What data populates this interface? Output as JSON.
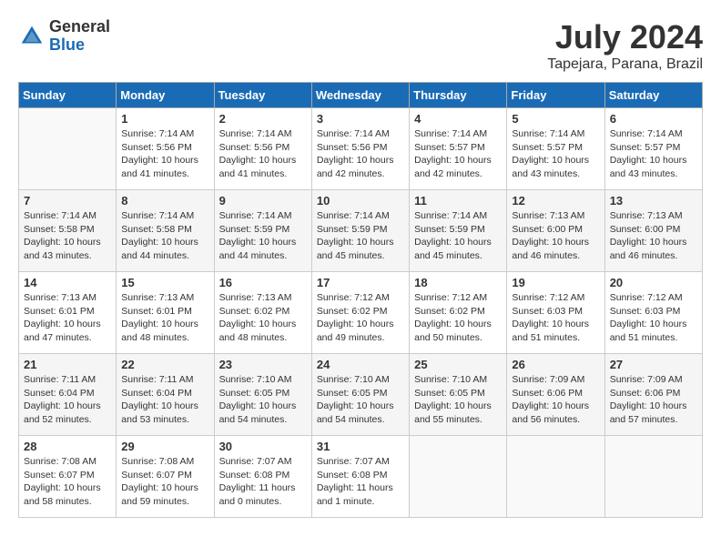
{
  "header": {
    "logo_general": "General",
    "logo_blue": "Blue",
    "month_year": "July 2024",
    "location": "Tapejara, Parana, Brazil"
  },
  "calendar": {
    "days_of_week": [
      "Sunday",
      "Monday",
      "Tuesday",
      "Wednesday",
      "Thursday",
      "Friday",
      "Saturday"
    ],
    "weeks": [
      [
        {
          "day": "",
          "info": ""
        },
        {
          "day": "1",
          "info": "Sunrise: 7:14 AM\nSunset: 5:56 PM\nDaylight: 10 hours\nand 41 minutes."
        },
        {
          "day": "2",
          "info": "Sunrise: 7:14 AM\nSunset: 5:56 PM\nDaylight: 10 hours\nand 41 minutes."
        },
        {
          "day": "3",
          "info": "Sunrise: 7:14 AM\nSunset: 5:56 PM\nDaylight: 10 hours\nand 42 minutes."
        },
        {
          "day": "4",
          "info": "Sunrise: 7:14 AM\nSunset: 5:57 PM\nDaylight: 10 hours\nand 42 minutes."
        },
        {
          "day": "5",
          "info": "Sunrise: 7:14 AM\nSunset: 5:57 PM\nDaylight: 10 hours\nand 43 minutes."
        },
        {
          "day": "6",
          "info": "Sunrise: 7:14 AM\nSunset: 5:57 PM\nDaylight: 10 hours\nand 43 minutes."
        }
      ],
      [
        {
          "day": "7",
          "info": "Sunrise: 7:14 AM\nSunset: 5:58 PM\nDaylight: 10 hours\nand 43 minutes."
        },
        {
          "day": "8",
          "info": "Sunrise: 7:14 AM\nSunset: 5:58 PM\nDaylight: 10 hours\nand 44 minutes."
        },
        {
          "day": "9",
          "info": "Sunrise: 7:14 AM\nSunset: 5:59 PM\nDaylight: 10 hours\nand 44 minutes."
        },
        {
          "day": "10",
          "info": "Sunrise: 7:14 AM\nSunset: 5:59 PM\nDaylight: 10 hours\nand 45 minutes."
        },
        {
          "day": "11",
          "info": "Sunrise: 7:14 AM\nSunset: 5:59 PM\nDaylight: 10 hours\nand 45 minutes."
        },
        {
          "day": "12",
          "info": "Sunrise: 7:13 AM\nSunset: 6:00 PM\nDaylight: 10 hours\nand 46 minutes."
        },
        {
          "day": "13",
          "info": "Sunrise: 7:13 AM\nSunset: 6:00 PM\nDaylight: 10 hours\nand 46 minutes."
        }
      ],
      [
        {
          "day": "14",
          "info": "Sunrise: 7:13 AM\nSunset: 6:01 PM\nDaylight: 10 hours\nand 47 minutes."
        },
        {
          "day": "15",
          "info": "Sunrise: 7:13 AM\nSunset: 6:01 PM\nDaylight: 10 hours\nand 48 minutes."
        },
        {
          "day": "16",
          "info": "Sunrise: 7:13 AM\nSunset: 6:02 PM\nDaylight: 10 hours\nand 48 minutes."
        },
        {
          "day": "17",
          "info": "Sunrise: 7:12 AM\nSunset: 6:02 PM\nDaylight: 10 hours\nand 49 minutes."
        },
        {
          "day": "18",
          "info": "Sunrise: 7:12 AM\nSunset: 6:02 PM\nDaylight: 10 hours\nand 50 minutes."
        },
        {
          "day": "19",
          "info": "Sunrise: 7:12 AM\nSunset: 6:03 PM\nDaylight: 10 hours\nand 51 minutes."
        },
        {
          "day": "20",
          "info": "Sunrise: 7:12 AM\nSunset: 6:03 PM\nDaylight: 10 hours\nand 51 minutes."
        }
      ],
      [
        {
          "day": "21",
          "info": "Sunrise: 7:11 AM\nSunset: 6:04 PM\nDaylight: 10 hours\nand 52 minutes."
        },
        {
          "day": "22",
          "info": "Sunrise: 7:11 AM\nSunset: 6:04 PM\nDaylight: 10 hours\nand 53 minutes."
        },
        {
          "day": "23",
          "info": "Sunrise: 7:10 AM\nSunset: 6:05 PM\nDaylight: 10 hours\nand 54 minutes."
        },
        {
          "day": "24",
          "info": "Sunrise: 7:10 AM\nSunset: 6:05 PM\nDaylight: 10 hours\nand 54 minutes."
        },
        {
          "day": "25",
          "info": "Sunrise: 7:10 AM\nSunset: 6:05 PM\nDaylight: 10 hours\nand 55 minutes."
        },
        {
          "day": "26",
          "info": "Sunrise: 7:09 AM\nSunset: 6:06 PM\nDaylight: 10 hours\nand 56 minutes."
        },
        {
          "day": "27",
          "info": "Sunrise: 7:09 AM\nSunset: 6:06 PM\nDaylight: 10 hours\nand 57 minutes."
        }
      ],
      [
        {
          "day": "28",
          "info": "Sunrise: 7:08 AM\nSunset: 6:07 PM\nDaylight: 10 hours\nand 58 minutes."
        },
        {
          "day": "29",
          "info": "Sunrise: 7:08 AM\nSunset: 6:07 PM\nDaylight: 10 hours\nand 59 minutes."
        },
        {
          "day": "30",
          "info": "Sunrise: 7:07 AM\nSunset: 6:08 PM\nDaylight: 11 hours\nand 0 minutes."
        },
        {
          "day": "31",
          "info": "Sunrise: 7:07 AM\nSunset: 6:08 PM\nDaylight: 11 hours\nand 1 minute."
        },
        {
          "day": "",
          "info": ""
        },
        {
          "day": "",
          "info": ""
        },
        {
          "day": "",
          "info": ""
        }
      ]
    ]
  }
}
